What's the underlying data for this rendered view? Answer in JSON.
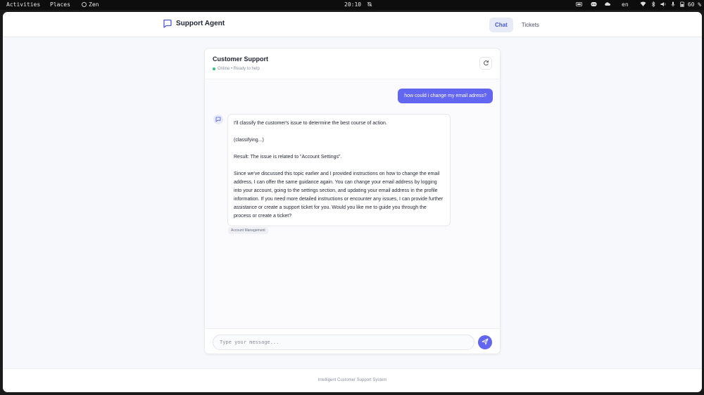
{
  "system_bar": {
    "activities": "Activities",
    "places": "Places",
    "app_name": "Zen",
    "clock": "20:10",
    "language": "en",
    "battery": "60 %"
  },
  "header": {
    "brand_title": "Support Agent",
    "brand_icon": "chat-bubble-icon",
    "tabs": [
      {
        "label": "Chat",
        "active": true
      },
      {
        "label": "Tickets",
        "active": false
      }
    ]
  },
  "chat": {
    "title": "Customer Support",
    "status": "Online • Ready to help",
    "messages": {
      "user": "how could i change my email adress?",
      "agent_lines": [
        "I'll classify the customer's issue to determine the best course of action.",
        "(classifying...)",
        "Result: The issue is related to \"Account Settings\".",
        "Since we've discussed this topic earlier and I provided instructions on how to change the email address, I can offer the same guidance again. You can change your email address by logging into your account, going to the settings section, and updating your email address in the profile information. If you need more detailed instructions or encounter any issues, I can provide further assistance or create a support ticket for you. Would you like me to guide you through the process or create a ticket?"
      ],
      "agent_tag": "Account Management"
    },
    "input": {
      "placeholder": "Type your message...",
      "value": ""
    }
  },
  "footer": {
    "text": "Intelligent Customer Support System"
  },
  "colors": {
    "accent": "#6366f1",
    "online": "#2ec27e",
    "active_tab_bg": "#e7ebf8"
  }
}
